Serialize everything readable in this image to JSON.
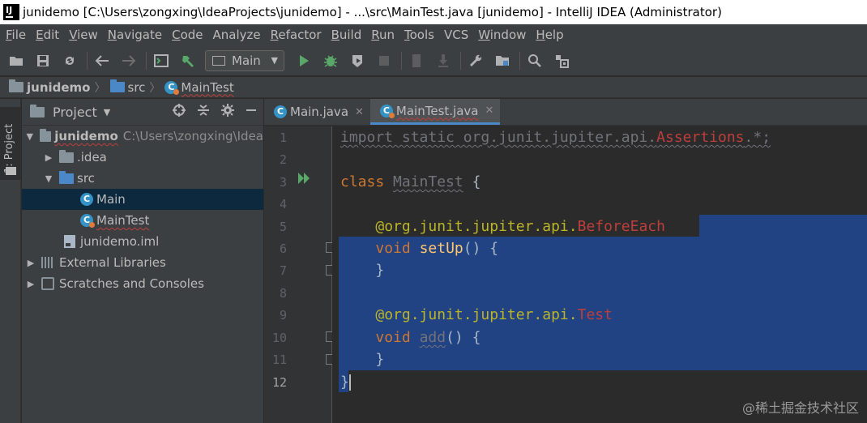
{
  "window": {
    "title": "junidemo [C:\\Users\\zongxing\\IdeaProjects\\junidemo] - ...\\src\\MainTest.java [junidemo] - IntelliJ IDEA (Administrator)"
  },
  "menu": [
    {
      "mn": "F",
      "rest": "ile"
    },
    {
      "mn": "E",
      "rest": "dit"
    },
    {
      "mn": "V",
      "rest": "iew"
    },
    {
      "mn": "N",
      "rest": "avigate"
    },
    {
      "mn": "C",
      "rest": "ode"
    },
    {
      "mn": "",
      "rest": "Analyze"
    },
    {
      "mn": "R",
      "rest": "efactor"
    },
    {
      "mn": "B",
      "rest": "uild"
    },
    {
      "mn": "R",
      "rest": "un",
      "plain": true
    },
    {
      "mn": "T",
      "rest": "ools"
    },
    {
      "mn": "",
      "rest": "VCS"
    },
    {
      "mn": "W",
      "rest": "indow"
    },
    {
      "mn": "H",
      "rest": "elp"
    }
  ],
  "toolbar": {
    "run_config": "Main"
  },
  "breadcrumb": {
    "project": "junidemo",
    "folder": "src",
    "file": "MainTest"
  },
  "side_strip": {
    "project_tab": "1: Project"
  },
  "project_panel": {
    "title": "Project",
    "root": {
      "name": "junidemo",
      "path": "C:\\Users\\zongxing\\Idea"
    },
    "idea": ".idea",
    "src": "src",
    "main": "Main",
    "maintest": "MainTest",
    "iml": "junidemo.iml",
    "ext_libs": "External Libraries",
    "scratches": "Scratches and Consoles"
  },
  "editor_tabs": [
    {
      "label": "Main.java",
      "active": false
    },
    {
      "label": "MainTest.java",
      "active": true
    }
  ],
  "code": {
    "line_numbers": [
      "1",
      "2",
      "3",
      "4",
      "5",
      "6",
      "7",
      "8",
      "9",
      "10",
      "11",
      "12"
    ],
    "l1_import": "import static org.junit.jupiter.api.",
    "l1_assertions": "Assertions",
    "l1_rest": ".*;",
    "l3_class": "class",
    "l3_name": "MainTest",
    "l3_brace": " {",
    "l5_ann": "@org.junit.jupiter.api.",
    "l5_name": "BeforeEach",
    "l6_void": "void",
    "l6_name": "setUp",
    "l6_rest": "() {",
    "l7_brace": "}",
    "l9_ann": "@org.junit.jupiter.api.",
    "l9_name": "Test",
    "l10_void": "void",
    "l10_name": "add",
    "l10_rest": "() {",
    "l11_brace": "}",
    "l12_brace": "}"
  },
  "watermark": "@稀土掘金技术社区",
  "colors": {
    "selection": "#214283",
    "keyword": "#cc7832",
    "annotation": "#bbb529",
    "error_red": "#bc3f3c",
    "method": "#ffc66d"
  }
}
